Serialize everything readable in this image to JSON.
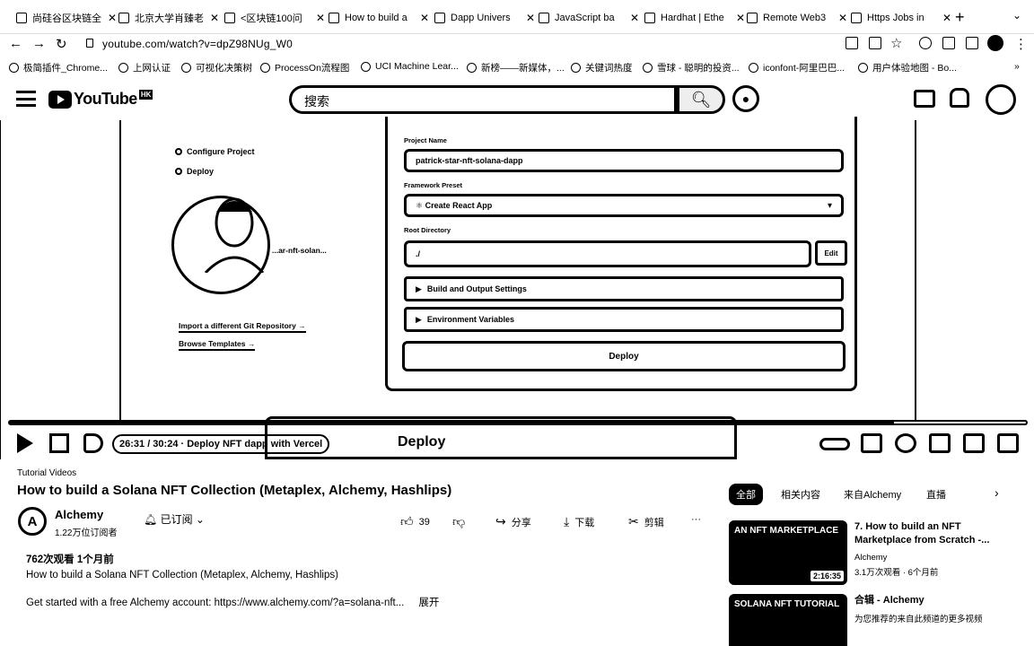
{
  "browser": {
    "tabs": [
      {
        "title": "尚硅谷区块链全"
      },
      {
        "title": "北京大学肖臻老"
      },
      {
        "title": "<区块链100问"
      },
      {
        "title": "How to build a"
      },
      {
        "title": "Dapp Univers"
      },
      {
        "title": "JavaScript ba"
      },
      {
        "title": "Hardhat | Ethe"
      },
      {
        "title": "Remote Web3"
      },
      {
        "title": "Https Jobs in"
      }
    ],
    "url": "youtube.com/watch?v=dpZ98NUg_W0",
    "bookmarks": [
      "极简插件_Chrome...",
      "上网认证",
      "可视化决策树",
      "ProcessOn流程图",
      "UCI Machine Lear...",
      "新榜——新媒体，...",
      "关键词热度",
      "雪球 - 聪明的投资...",
      "iconfont-阿里巴巴...",
      "用户体验地图 - Bo..."
    ]
  },
  "youtube": {
    "logo_text": "YouTube",
    "region": "HK",
    "search_placeholder": "搜索"
  },
  "video": {
    "left_panel": {
      "step1": "Configure Project",
      "step2": "Deploy",
      "repo": "...ar-nft-solan...",
      "link1": "Import a different Git Repository →",
      "link2": "Browse Templates →"
    },
    "deploy_form": {
      "project_name_label": "Project Name",
      "project_name_value": "patrick-star-nft-solana-dapp",
      "framework_label": "Framework Preset",
      "framework_value": "Create React App",
      "root_dir_label": "Root Directory",
      "root_dir_value": "./",
      "edit_label": "Edit",
      "build_settings": "Build and Output Settings",
      "env_vars": "Environment Variables",
      "deploy_label": "Deploy"
    },
    "progress_fraction": 0.87,
    "time_text": "26:31 / 30:24 · Deploy NFT dapp with Vercel",
    "watermark": "Deploy"
  },
  "info": {
    "category": "Tutorial Videos",
    "title": "How to build a Solana NFT Collection (Metaplex, Alchemy, Hashlips)",
    "channel": "Alchemy",
    "subscribers": "1.22万位订阅者",
    "subscribe_label": "已订阅",
    "likes": "39",
    "share": "分享",
    "download": "下载",
    "clip": "剪辑",
    "more": "···",
    "desc_stats": "762次观看  1个月前",
    "desc_line1": "How to build a Solana NFT Collection (Metaplex, Alchemy, Hashlips)",
    "desc_line2": "Get started with a free Alchemy account: https://www.alchemy.com/?a=solana-nft...",
    "desc_more": "展开"
  },
  "sidebar": {
    "chips": [
      "全部",
      "相关内容",
      "来自Alchemy",
      "直播"
    ],
    "recs": [
      {
        "thumb_text": "AN NFT MARKETPLACE",
        "duration": "2:16:35",
        "title": "7. How to build an NFT Marketplace from Scratch -...",
        "channel": "Alchemy",
        "meta": "3.1万次观看 · 6个月前"
      },
      {
        "thumb_text": "SOLANA NFT TUTORIAL",
        "duration": "",
        "title": "合辑 - Alchemy",
        "channel": "",
        "meta": "为您推荐的来自此频道的更多视频"
      }
    ]
  }
}
